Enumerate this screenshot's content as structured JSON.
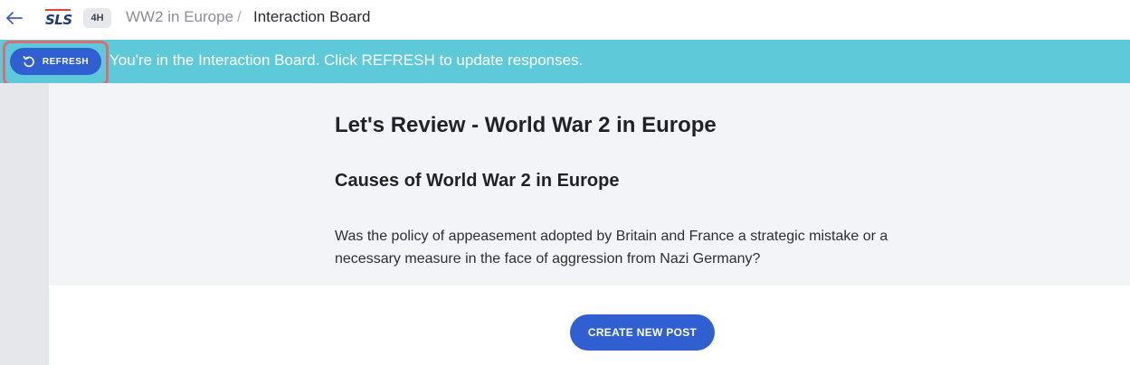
{
  "header": {
    "logo_text": "SLS",
    "level_badge": "4H",
    "breadcrumb_parent": "WW2 in Europe",
    "breadcrumb_separator": "/",
    "breadcrumb_current": "Interaction Board",
    "back_icon": "arrow-left-icon"
  },
  "banner": {
    "refresh_label": "REFRESH",
    "refresh_icon": "undo-refresh-icon",
    "message": "You're in the Interaction Board. Click REFRESH to update responses.",
    "color": "#5ec9d8"
  },
  "board": {
    "title": "Let's Review - World War 2 in Europe",
    "section_title": "Causes of World War 2 in Europe",
    "question": "Was the policy of appeasement adopted by Britain and France a strategic mistake or a necessary measure in the face of aggression from Nazi Germany?",
    "create_post_label": "CREATE NEW POST"
  },
  "colors": {
    "primary_button": "#2f5fd0",
    "highlight_outline": "#e06a72",
    "logo_red": "#e0453c",
    "logo_blue": "#1d3a7a"
  }
}
